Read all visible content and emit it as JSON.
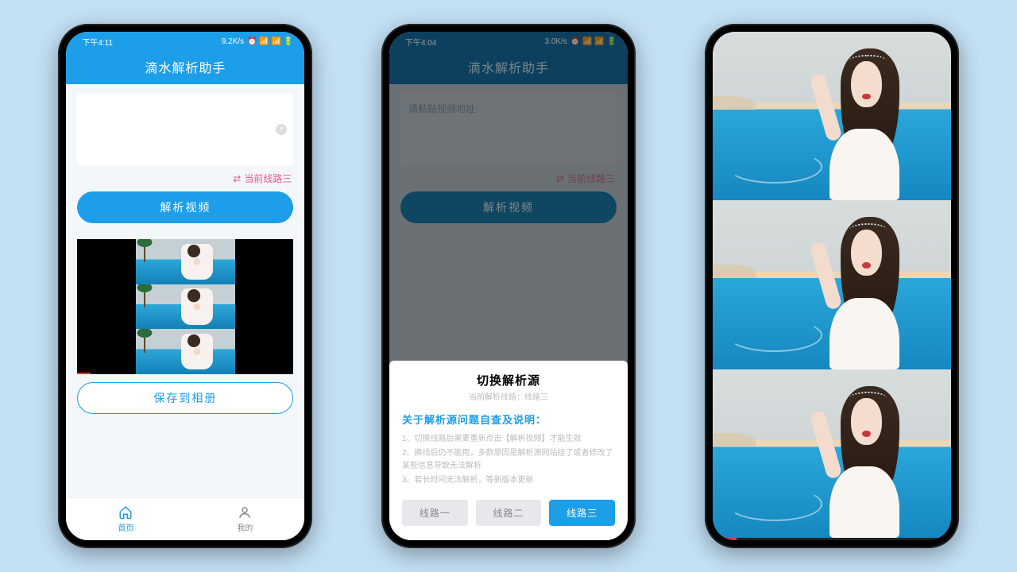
{
  "phone1": {
    "status": {
      "time": "下午4:11",
      "net": "9.2K/s",
      "icons": "⏰ 📶 📶 🔋"
    },
    "app_title": "滴水解析助手",
    "input_placeholder": "",
    "route_label": "当前线路三",
    "parse_btn": "解析视频",
    "save_btn": "保存到相册",
    "nav": {
      "home": "首页",
      "mine": "我的"
    }
  },
  "phone2": {
    "status": {
      "time": "下午4:04",
      "net": "3.0K/s",
      "icons": "⏰ 📶 📶 🔋"
    },
    "app_title": "滴水解析助手",
    "input_placeholder": "请粘贴视频地址",
    "route_label": "当前线路三",
    "parse_btn": "解析视频",
    "sheet": {
      "title": "切换解析源",
      "sub": "当前解析线路：线路三",
      "heading": "关于解析源问题自查及说明：",
      "note1": "1、切换线路后需要重新点击【解析视频】才能生效",
      "note2": "2、换线后仍不能用，多数原因是解析源网站挂了或者修改了某些信息导致无法解析",
      "note3": "3、若长时间无法解析，等新版本更新",
      "routes": [
        "线路一",
        "线路二",
        "线路三"
      ],
      "active_route_index": 2
    }
  }
}
